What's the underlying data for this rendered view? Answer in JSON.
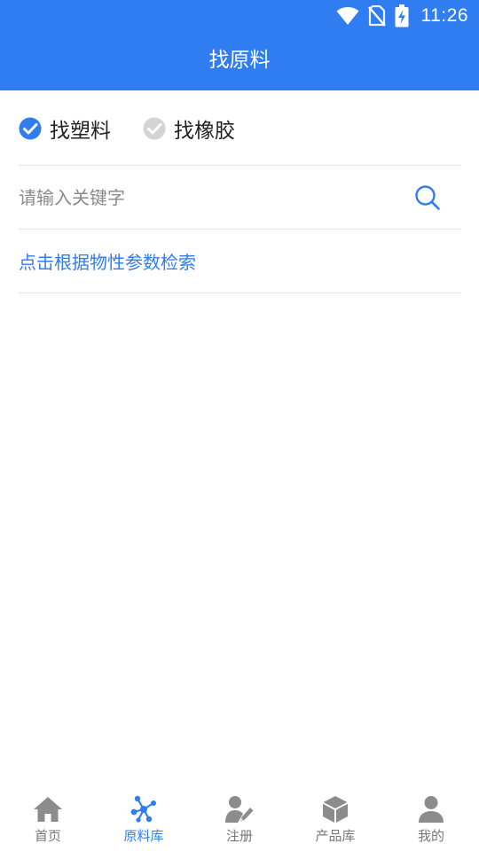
{
  "status_bar": {
    "time": "11:26"
  },
  "header": {
    "title": "找原料"
  },
  "material_type": {
    "options": [
      {
        "label": "找塑料",
        "selected": true
      },
      {
        "label": "找橡胶",
        "selected": false
      }
    ]
  },
  "search": {
    "placeholder": "请输入关键字",
    "value": ""
  },
  "property_search": {
    "label": "点击根据物性参数检索"
  },
  "bottom_nav": {
    "items": [
      {
        "label": "首页",
        "icon": "home-icon",
        "active": false
      },
      {
        "label": "原料库",
        "icon": "molecule-icon",
        "active": true
      },
      {
        "label": "注册",
        "icon": "user-edit-icon",
        "active": false
      },
      {
        "label": "产品库",
        "icon": "box-icon",
        "active": false
      },
      {
        "label": "我的",
        "icon": "person-icon",
        "active": false
      }
    ]
  },
  "colors": {
    "primary": "#2f7df0",
    "inactive_icon": "#8c8c8c",
    "unchecked_radio": "#d4d4d4"
  }
}
